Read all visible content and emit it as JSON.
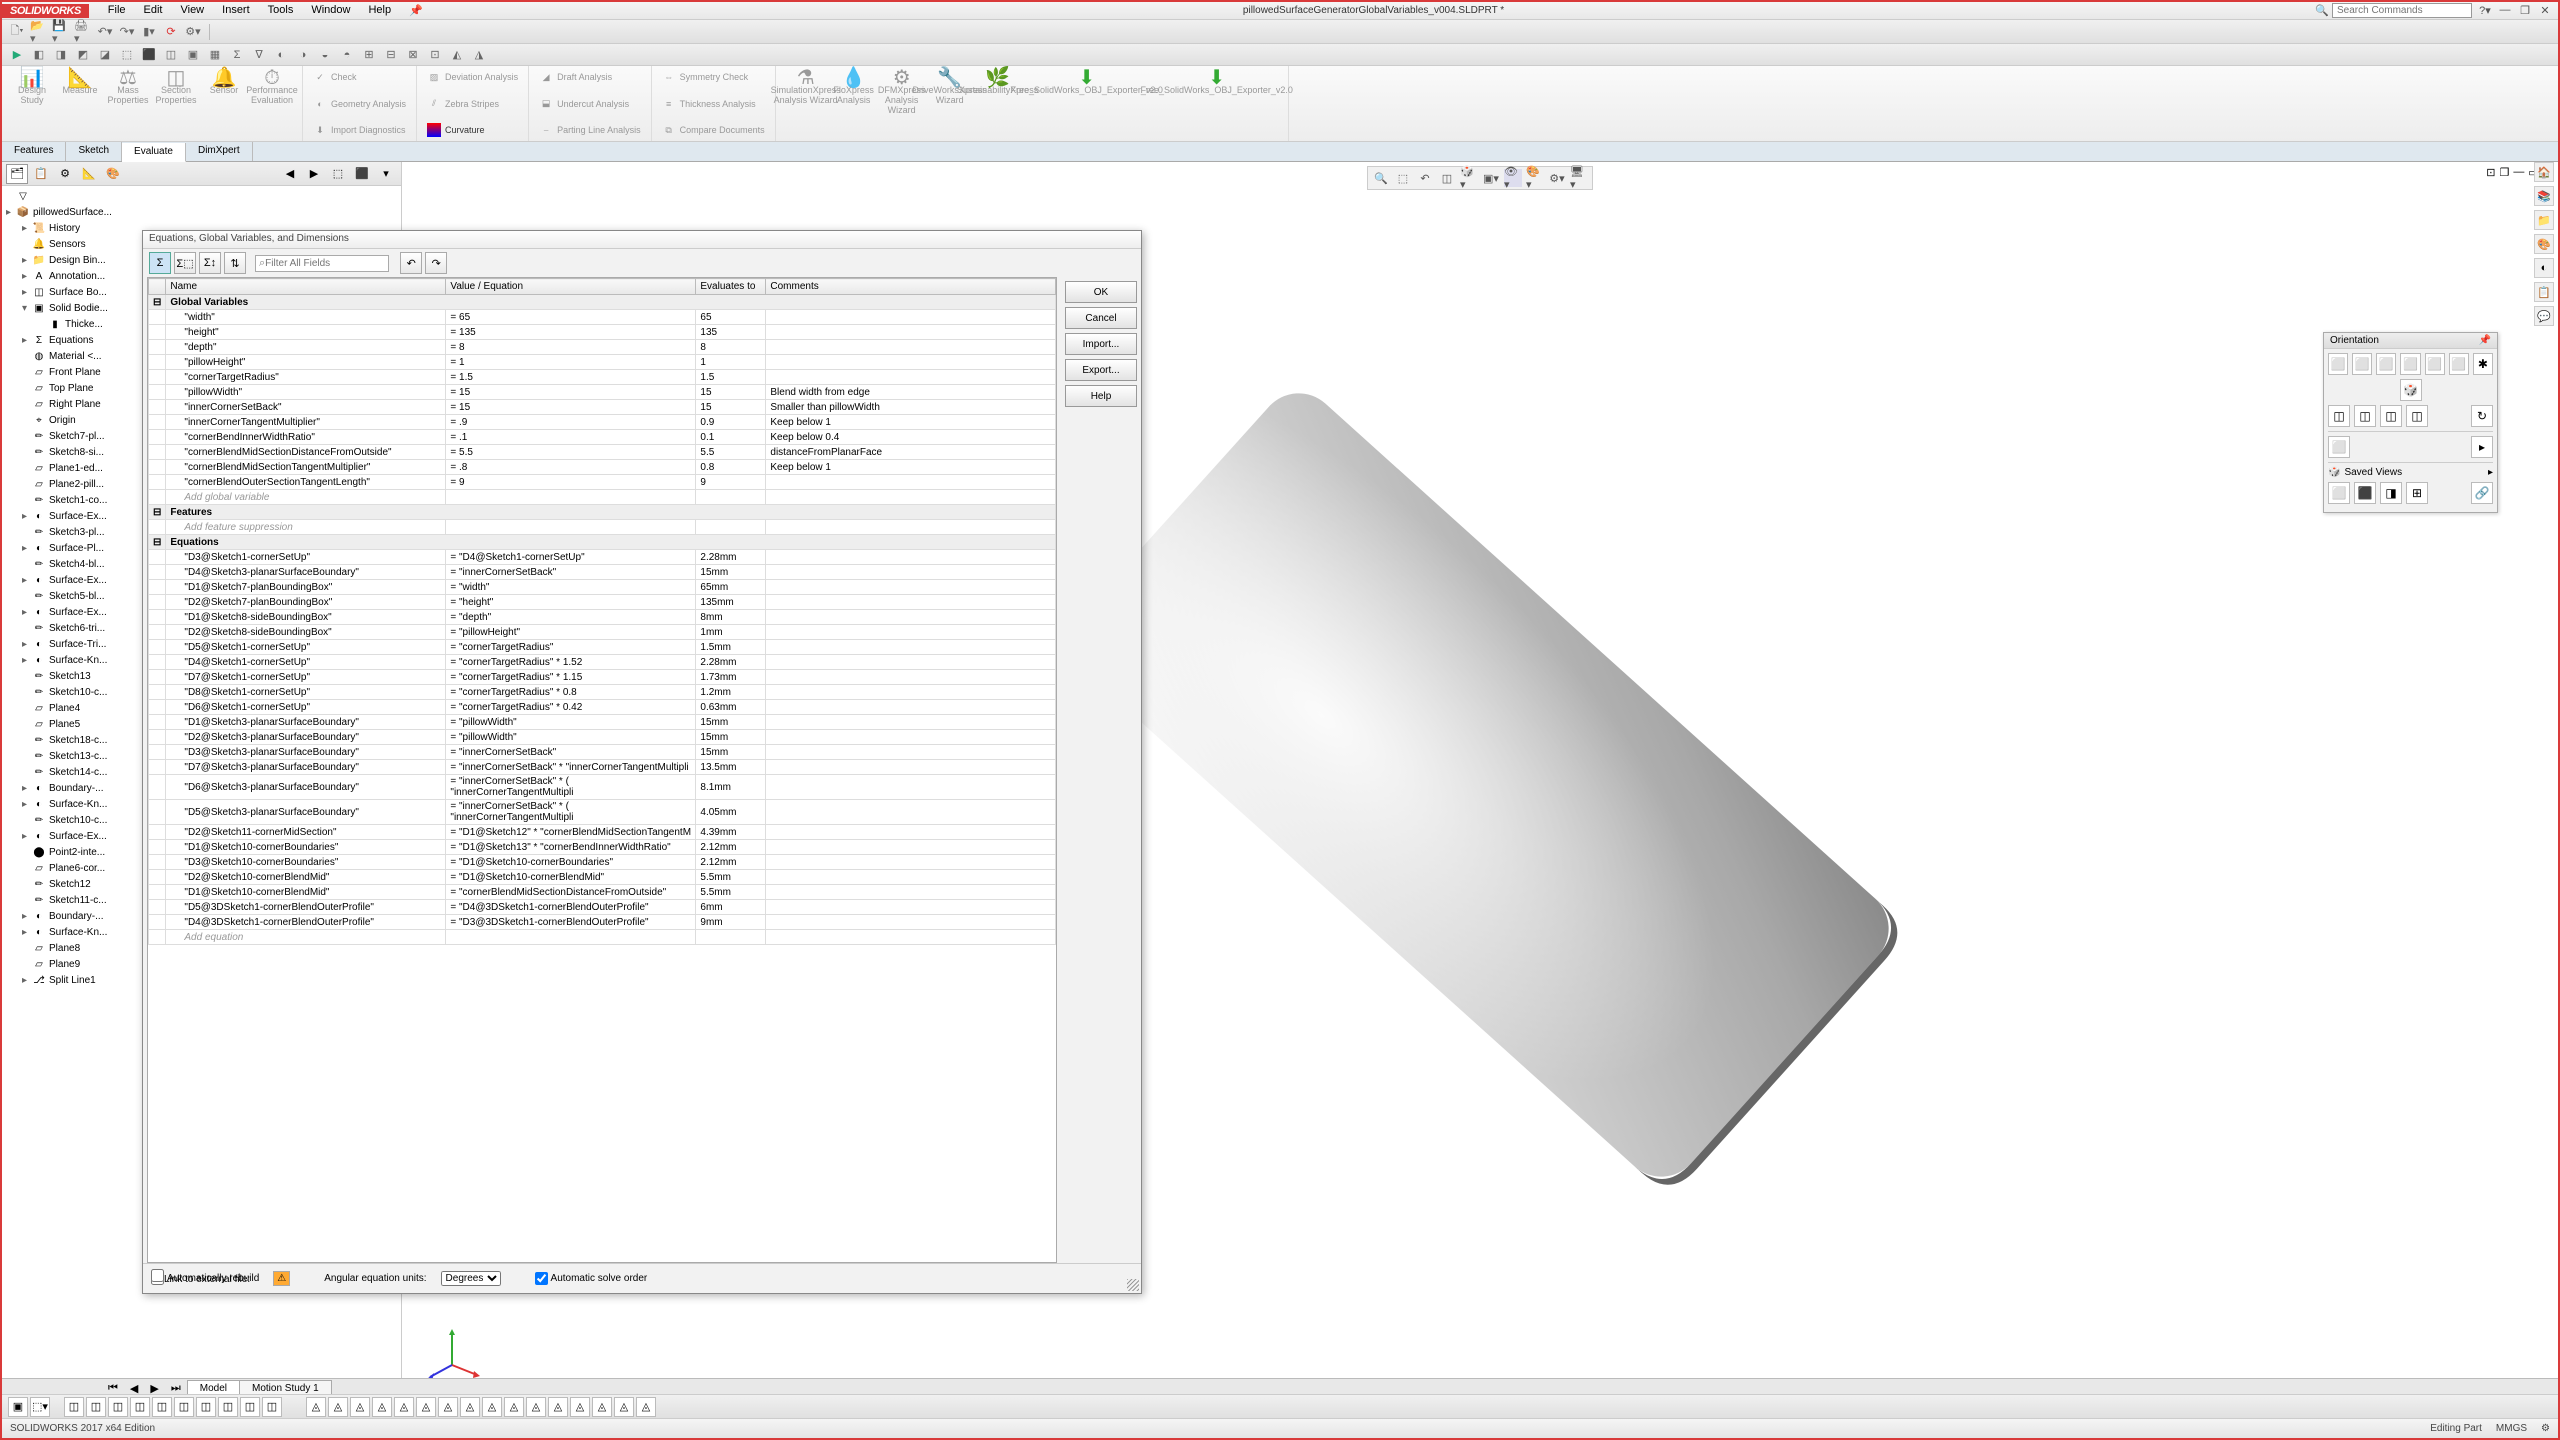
{
  "app": {
    "logo": "SOLIDWORKS",
    "title": "pillowedSurfaceGeneratorGlobalVariables_v004.SLDPRT *"
  },
  "menu": [
    "File",
    "Edit",
    "View",
    "Insert",
    "Tools",
    "Window",
    "Help"
  ],
  "search_placeholder": "Search Commands",
  "cmtabs": [
    "Features",
    "Sketch",
    "Evaluate",
    "DimXpert"
  ],
  "cmtabs_active": 2,
  "ribbon": {
    "g1": [
      {
        "l": "Design\nStudy"
      },
      {
        "l": "Measure"
      },
      {
        "l": "Mass\nProperties"
      },
      {
        "l": "Section\nProperties"
      },
      {
        "l": "Sensor"
      }
    ],
    "g1b": "Performance\nEvaluation",
    "g2": [
      "Check",
      "Geometry Analysis",
      "Import Diagnostics"
    ],
    "g3": [
      "Deviation Analysis",
      "Zebra Stripes",
      "Curvature"
    ],
    "g4": [
      "Draft Analysis",
      "Undercut Analysis",
      "Parting Line Analysis"
    ],
    "g5": [
      "Symmetry Check",
      "Thickness Analysis",
      "Compare Documents"
    ],
    "g6": [
      {
        "l": "SimulationXpress\nAnalysis Wizard"
      },
      {
        "l": "FloXpress\nAnalysis"
      },
      {
        "l": "DFMXpress\nAnalysis\nWizard"
      },
      {
        "l": "DriveWorksXpress\nWizard"
      },
      {
        "l": "SustainabilityXpress"
      },
      {
        "l": "Free_SolidWorks_OBJ_Exporter_v2.0"
      },
      {
        "l": "Free_SolidWorks_OBJ_Exporter_v2.0"
      }
    ]
  },
  "tree": [
    {
      "lvl": 0,
      "ico": "▽",
      "txt": ""
    },
    {
      "lvl": 0,
      "ico": "📦",
      "txt": "pillowedSurface...",
      "tog": "▸"
    },
    {
      "lvl": 1,
      "ico": "📜",
      "txt": "History",
      "tog": "▸"
    },
    {
      "lvl": 1,
      "ico": "🔔",
      "txt": "Sensors"
    },
    {
      "lvl": 1,
      "ico": "📁",
      "txt": "Design Bin...",
      "tog": "▸"
    },
    {
      "lvl": 1,
      "ico": "A",
      "txt": "Annotation...",
      "tog": "▸"
    },
    {
      "lvl": 1,
      "ico": "◫",
      "txt": "Surface Bo...",
      "tog": "▸"
    },
    {
      "lvl": 1,
      "ico": "▣",
      "txt": "Solid Bodie...",
      "tog": "▾"
    },
    {
      "lvl": 2,
      "ico": "▮",
      "txt": "Thicke..."
    },
    {
      "lvl": 1,
      "ico": "Σ",
      "txt": "Equations",
      "tog": "▸"
    },
    {
      "lvl": 1,
      "ico": "◍",
      "txt": "Material <...",
      "tog": ""
    },
    {
      "lvl": 1,
      "ico": "▱",
      "txt": "Front Plane"
    },
    {
      "lvl": 1,
      "ico": "▱",
      "txt": "Top Plane"
    },
    {
      "lvl": 1,
      "ico": "▱",
      "txt": "Right Plane"
    },
    {
      "lvl": 1,
      "ico": "⌖",
      "txt": "Origin"
    },
    {
      "lvl": 1,
      "ico": "✏",
      "txt": "Sketch7-pl..."
    },
    {
      "lvl": 1,
      "ico": "✏",
      "txt": "Sketch8-si..."
    },
    {
      "lvl": 1,
      "ico": "▱",
      "txt": "Plane1-ed..."
    },
    {
      "lvl": 1,
      "ico": "▱",
      "txt": "Plane2-pill..."
    },
    {
      "lvl": 1,
      "ico": "✏",
      "txt": "Sketch1-co..."
    },
    {
      "lvl": 1,
      "ico": "◐",
      "txt": "Surface-Ex...",
      "tog": "▸"
    },
    {
      "lvl": 1,
      "ico": "✏",
      "txt": "Sketch3-pl..."
    },
    {
      "lvl": 1,
      "ico": "◐",
      "txt": "Surface-Pl...",
      "tog": "▸"
    },
    {
      "lvl": 1,
      "ico": "✏",
      "txt": "Sketch4-bl..."
    },
    {
      "lvl": 1,
      "ico": "◐",
      "txt": "Surface-Ex...",
      "tog": "▸"
    },
    {
      "lvl": 1,
      "ico": "✏",
      "txt": "Sketch5-bl..."
    },
    {
      "lvl": 1,
      "ico": "◐",
      "txt": "Surface-Ex...",
      "tog": "▸"
    },
    {
      "lvl": 1,
      "ico": "✏",
      "txt": "Sketch6-tri..."
    },
    {
      "lvl": 1,
      "ico": "◐",
      "txt": "Surface-Tri...",
      "tog": "▸"
    },
    {
      "lvl": 1,
      "ico": "◐",
      "txt": "Surface-Kn...",
      "tog": "▸"
    },
    {
      "lvl": 1,
      "ico": "✏",
      "txt": "Sketch13"
    },
    {
      "lvl": 1,
      "ico": "✏",
      "txt": "Sketch10-c..."
    },
    {
      "lvl": 1,
      "ico": "▱",
      "txt": "Plane4"
    },
    {
      "lvl": 1,
      "ico": "▱",
      "txt": "Plane5"
    },
    {
      "lvl": 1,
      "ico": "✏",
      "txt": "Sketch18-c..."
    },
    {
      "lvl": 1,
      "ico": "✏",
      "txt": "Sketch13-c..."
    },
    {
      "lvl": 1,
      "ico": "✏",
      "txt": "Sketch14-c..."
    },
    {
      "lvl": 1,
      "ico": "◐",
      "txt": "Boundary-...",
      "tog": "▸"
    },
    {
      "lvl": 1,
      "ico": "◐",
      "txt": "Surface-Kn...",
      "tog": "▸"
    },
    {
      "lvl": 1,
      "ico": "✏",
      "txt": "Sketch10-c..."
    },
    {
      "lvl": 1,
      "ico": "◐",
      "txt": "Surface-Ex...",
      "tog": "▸"
    },
    {
      "lvl": 1,
      "ico": "⬤",
      "txt": "Point2-inte..."
    },
    {
      "lvl": 1,
      "ico": "▱",
      "txt": "Plane6-cor..."
    },
    {
      "lvl": 1,
      "ico": "✏",
      "txt": "Sketch12"
    },
    {
      "lvl": 1,
      "ico": "✏",
      "txt": "Sketch11-c..."
    },
    {
      "lvl": 1,
      "ico": "◐",
      "txt": "Boundary-...",
      "tog": "▸"
    },
    {
      "lvl": 1,
      "ico": "◐",
      "txt": "Surface-Kn...",
      "tog": "▸"
    },
    {
      "lvl": 1,
      "ico": "▱",
      "txt": "Plane8"
    },
    {
      "lvl": 1,
      "ico": "▱",
      "txt": "Plane9"
    },
    {
      "lvl": 1,
      "ico": "⎇",
      "txt": "Split Line1",
      "tog": "▸"
    }
  ],
  "dlg": {
    "title": "Equations, Global Variables, and Dimensions",
    "filter_placeholder": "Filter All Fields",
    "headers": [
      "Name",
      "Value / Equation",
      "Evaluates to",
      "Comments"
    ],
    "buttons": {
      "ok": "OK",
      "cancel": "Cancel",
      "import": "Import...",
      "export": "Export...",
      "help": "Help"
    },
    "sections": [
      {
        "title": "Global Variables",
        "rows": [
          {
            "n": "\"width\"",
            "v": "= 65",
            "e": "65",
            "c": ""
          },
          {
            "n": "\"height\"",
            "v": "= 135",
            "e": "135",
            "c": ""
          },
          {
            "n": "\"depth\"",
            "v": "= 8",
            "e": "8",
            "c": ""
          },
          {
            "n": "\"pillowHeight\"",
            "v": "= 1",
            "e": "1",
            "c": ""
          },
          {
            "n": "\"cornerTargetRadius\"",
            "v": "= 1.5",
            "e": "1.5",
            "c": ""
          },
          {
            "n": "\"pillowWidth\"",
            "v": "= 15",
            "e": "15",
            "c": "Blend width from edge"
          },
          {
            "n": "\"innerCornerSetBack\"",
            "v": "= 15",
            "e": "15",
            "c": "Smaller than pillowWidth"
          },
          {
            "n": "\"innerCornerTangentMultiplier\"",
            "v": "= .9",
            "e": "0.9",
            "c": "Keep below 1"
          },
          {
            "n": "\"cornerBendInnerWidthRatio\"",
            "v": "= .1",
            "e": "0.1",
            "c": "Keep below 0.4"
          },
          {
            "n": "\"cornerBlendMidSectionDistanceFromOutside\"",
            "v": "= 5.5",
            "e": "5.5",
            "c": "distanceFromPlanarFace"
          },
          {
            "n": "\"cornerBlendMidSectionTangentMultiplier\"",
            "v": "= .8",
            "e": "0.8",
            "c": "Keep below 1"
          },
          {
            "n": "\"cornerBlendOuterSectionTangentLength\"",
            "v": "= 9",
            "e": "9",
            "c": ""
          }
        ],
        "placeholder": "Add global variable"
      },
      {
        "title": "Features",
        "rows": [],
        "placeholder": "Add feature suppression"
      },
      {
        "title": "Equations",
        "rows": [
          {
            "n": "\"D3@Sketch1-cornerSetUp\"",
            "v": "= \"D4@Sketch1-cornerSetUp\"",
            "e": "2.28mm",
            "c": ""
          },
          {
            "n": "\"D4@Sketch3-planarSurfaceBoundary\"",
            "v": "= \"innerCornerSetBack\"",
            "e": "15mm",
            "c": ""
          },
          {
            "n": "\"D1@Sketch7-planBoundingBox\"",
            "v": "= \"width\"",
            "e": "65mm",
            "c": ""
          },
          {
            "n": "\"D2@Sketch7-planBoundingBox\"",
            "v": "= \"height\"",
            "e": "135mm",
            "c": ""
          },
          {
            "n": "\"D1@Sketch8-sideBoundingBox\"",
            "v": "= \"depth\"",
            "e": "8mm",
            "c": ""
          },
          {
            "n": "\"D2@Sketch8-sideBoundingBox\"",
            "v": "= \"pillowHeight\"",
            "e": "1mm",
            "c": ""
          },
          {
            "n": "\"D5@Sketch1-cornerSetUp\"",
            "v": "= \"cornerTargetRadius\"",
            "e": "1.5mm",
            "c": ""
          },
          {
            "n": "\"D4@Sketch1-cornerSetUp\"",
            "v": "= \"cornerTargetRadius\" * 1.52",
            "e": "2.28mm",
            "c": ""
          },
          {
            "n": "\"D7@Sketch1-cornerSetUp\"",
            "v": "= \"cornerTargetRadius\" * 1.15",
            "e": "1.73mm",
            "c": ""
          },
          {
            "n": "\"D8@Sketch1-cornerSetUp\"",
            "v": "= \"cornerTargetRadius\" * 0.8",
            "e": "1.2mm",
            "c": ""
          },
          {
            "n": "\"D6@Sketch1-cornerSetUp\"",
            "v": "= \"cornerTargetRadius\" * 0.42",
            "e": "0.63mm",
            "c": ""
          },
          {
            "n": "\"D1@Sketch3-planarSurfaceBoundary\"",
            "v": "= \"pillowWidth\"",
            "e": "15mm",
            "c": ""
          },
          {
            "n": "\"D2@Sketch3-planarSurfaceBoundary\"",
            "v": "= \"pillowWidth\"",
            "e": "15mm",
            "c": ""
          },
          {
            "n": "\"D3@Sketch3-planarSurfaceBoundary\"",
            "v": "= \"innerCornerSetBack\"",
            "e": "15mm",
            "c": ""
          },
          {
            "n": "\"D7@Sketch3-planarSurfaceBoundary\"",
            "v": "= \"innerCornerSetBack\" * \"innerCornerTangentMultipli",
            "e": "13.5mm",
            "c": ""
          },
          {
            "n": "\"D6@Sketch3-planarSurfaceBoundary\"",
            "v": "= \"innerCornerSetBack\" * ( \"innerCornerTangentMultipli",
            "e": "8.1mm",
            "c": ""
          },
          {
            "n": "\"D5@Sketch3-planarSurfaceBoundary\"",
            "v": "= \"innerCornerSetBack\" * ( \"innerCornerTangentMultipli",
            "e": "4.05mm",
            "c": ""
          },
          {
            "n": "\"D2@Sketch11-cornerMidSection\"",
            "v": "= \"D1@Sketch12\" * \"cornerBlendMidSectionTangentM",
            "e": "4.39mm",
            "c": ""
          },
          {
            "n": "\"D1@Sketch10-cornerBoundaries\"",
            "v": "= \"D1@Sketch13\" * \"cornerBendInnerWidthRatio\"",
            "e": "2.12mm",
            "c": ""
          },
          {
            "n": "\"D3@Sketch10-cornerBoundaries\"",
            "v": "= \"D1@Sketch10-cornerBoundaries\"",
            "e": "2.12mm",
            "c": ""
          },
          {
            "n": "\"D2@Sketch10-cornerBlendMid\"",
            "v": "= \"D1@Sketch10-cornerBlendMid\"",
            "e": "5.5mm",
            "c": ""
          },
          {
            "n": "\"D1@Sketch10-cornerBlendMid\"",
            "v": "= \"cornerBlendMidSectionDistanceFromOutside\"",
            "e": "5.5mm",
            "c": ""
          },
          {
            "n": "\"D5@3DSketch1-cornerBlendOuterProfile\"",
            "v": "= \"D4@3DSketch1-cornerBlendOuterProfile\"",
            "e": "6mm",
            "c": ""
          },
          {
            "n": "\"D4@3DSketch1-cornerBlendOuterProfile\"",
            "v": "= \"D3@3DSketch1-cornerBlendOuterProfile\"",
            "e": "9mm",
            "c": ""
          }
        ],
        "placeholder": "Add equation"
      }
    ],
    "foot": {
      "auto_rebuild": "Automatically rebuild",
      "link_ext": "Link to external file:",
      "ang_units": "Angular equation units:",
      "ang_val": "Degrees",
      "auto_solve": "Automatic solve order"
    }
  },
  "orient": {
    "title": "Orientation",
    "saved": "Saved Views"
  },
  "bottom_tabs": [
    "Model",
    "Motion Study 1"
  ],
  "status": {
    "left": "SOLIDWORKS 2017 x64 Edition",
    "right1": "Editing Part",
    "right2": "MMGS"
  }
}
